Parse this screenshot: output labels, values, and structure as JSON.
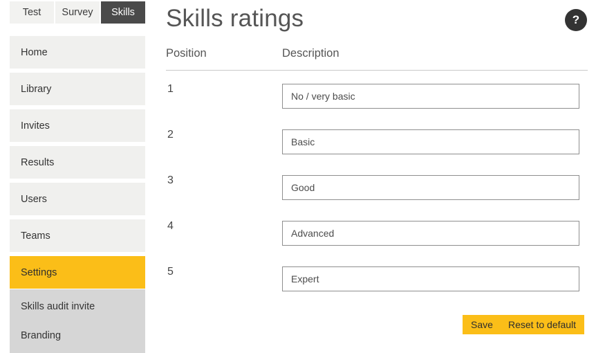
{
  "tabs": [
    {
      "label": "Test",
      "active": false
    },
    {
      "label": "Survey",
      "active": false
    },
    {
      "label": "Skills",
      "active": true
    }
  ],
  "sidebar": {
    "items": [
      {
        "label": "Home",
        "active": false
      },
      {
        "label": "Library",
        "active": false
      },
      {
        "label": "Invites",
        "active": false
      },
      {
        "label": "Results",
        "active": false
      },
      {
        "label": "Users",
        "active": false
      },
      {
        "label": "Teams",
        "active": false
      },
      {
        "label": "Settings",
        "active": true
      }
    ],
    "submenu": [
      {
        "label": "Skills audit invite"
      },
      {
        "label": "Branding"
      }
    ]
  },
  "header": {
    "title": "Skills ratings",
    "help_icon": "question-mark-icon",
    "help_glyph": "?"
  },
  "table": {
    "columns": [
      "Position",
      "Description"
    ],
    "rows": [
      {
        "position": "1",
        "description": "No / very basic"
      },
      {
        "position": "2",
        "description": "Basic"
      },
      {
        "position": "3",
        "description": "Good"
      },
      {
        "position": "4",
        "description": "Advanced"
      },
      {
        "position": "5",
        "description": "Expert"
      }
    ]
  },
  "buttons": {
    "save_label": "Save",
    "reset_label": "Reset to default"
  },
  "colors": {
    "accent": "#fbbe18",
    "active_tab": "#4a4a4a",
    "nav_item_bg": "#f0f0ee",
    "submenu_bg": "#d6d6d6"
  }
}
